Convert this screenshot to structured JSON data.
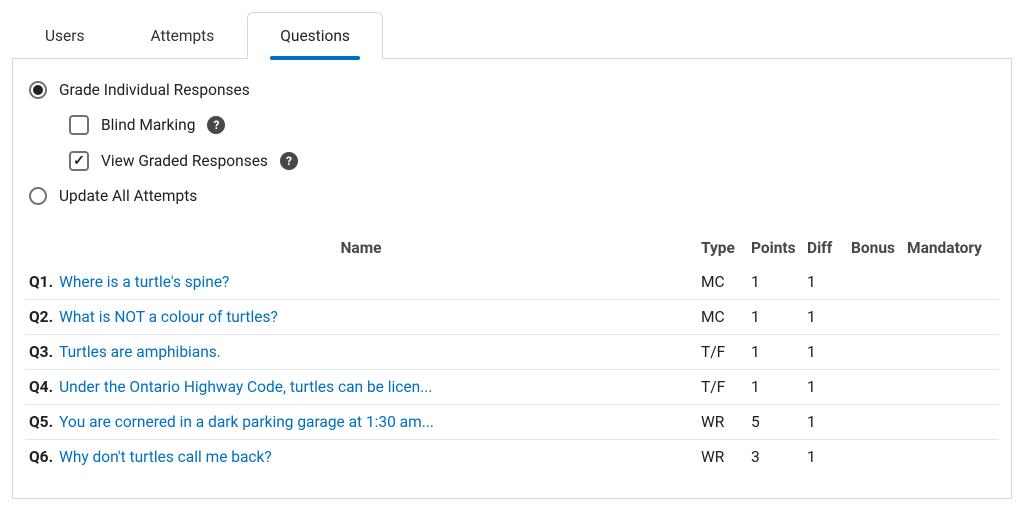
{
  "tabs": {
    "users": "Users",
    "attempts": "Attempts",
    "questions": "Questions"
  },
  "options": {
    "grade_individual": "Grade Individual Responses",
    "blind_marking": "Blind Marking",
    "view_graded": "View Graded Responses",
    "update_all": "Update All Attempts",
    "help_glyph": "?"
  },
  "table": {
    "headers": {
      "name": "Name",
      "type": "Type",
      "points": "Points",
      "diff": "Diff",
      "bonus": "Bonus",
      "mandatory": "Mandatory"
    },
    "rows": [
      {
        "num": "Q1.",
        "title": "Where is a turtle's spine?",
        "type": "MC",
        "points": "1",
        "diff": "1",
        "bonus": "",
        "mandatory": ""
      },
      {
        "num": "Q2.",
        "title": "What is NOT a colour of turtles?",
        "type": "MC",
        "points": "1",
        "diff": "1",
        "bonus": "",
        "mandatory": ""
      },
      {
        "num": "Q3.",
        "title": "Turtles are amphibians.",
        "type": "T/F",
        "points": "1",
        "diff": "1",
        "bonus": "",
        "mandatory": ""
      },
      {
        "num": "Q4.",
        "title": "Under the Ontario Highway Code, turtles can be licen...",
        "type": "T/F",
        "points": "1",
        "diff": "1",
        "bonus": "",
        "mandatory": ""
      },
      {
        "num": "Q5.",
        "title": "You are cornered in a dark parking garage at 1:30 am...",
        "type": "WR",
        "points": "5",
        "diff": "1",
        "bonus": "",
        "mandatory": ""
      },
      {
        "num": "Q6.",
        "title": "Why don't turtles call me back?",
        "type": "WR",
        "points": "3",
        "diff": "1",
        "bonus": "",
        "mandatory": ""
      }
    ]
  }
}
